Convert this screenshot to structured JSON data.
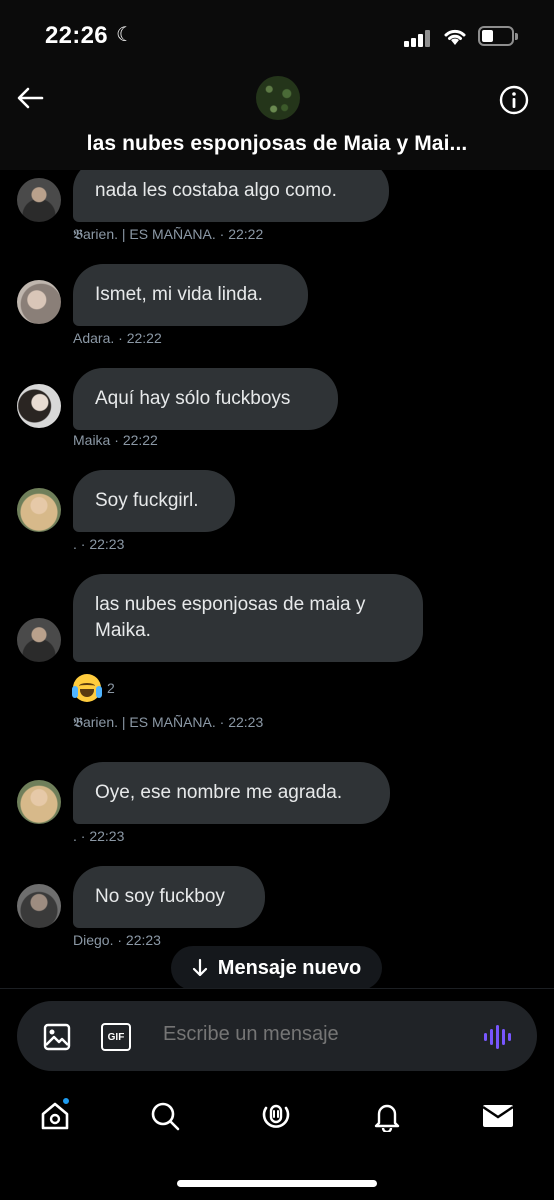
{
  "status_bar": {
    "time": "22:26"
  },
  "header": {
    "title": "las nubes esponjosas de Maia y Mai..."
  },
  "messages": [
    {
      "text": "nada les costaba algo como.",
      "author": "𝕭arien. | ES MAÑANA.",
      "time": "22:22"
    },
    {
      "text": "Ismet, mi vida linda.",
      "author": "Adara.",
      "time": "22:22"
    },
    {
      "text": "Aquí hay sólo fuckboys",
      "author": "Maika",
      "time": "22:22"
    },
    {
      "text": "Soy fuckgirl.",
      "author": ".",
      "time": "22:23"
    },
    {
      "text": "las nubes esponjosas de maia y Maika.",
      "author": "𝕭arien. | ES MAÑANA.",
      "time": "22:23",
      "reaction_count": "2"
    },
    {
      "text": "Oye, ese nombre me agrada.",
      "author": ".",
      "time": "22:23"
    },
    {
      "text": "No soy fuckboy",
      "author": "Diego.",
      "time": "22:23"
    }
  ],
  "new_message_pill": {
    "label": "Mensaje nuevo"
  },
  "composer": {
    "placeholder": "Escribe un mensaje",
    "gif_label": "GIF"
  },
  "colors": {
    "bubble": "#2f3336",
    "accent": "#1d9bf0",
    "voice": "#7856ff"
  }
}
